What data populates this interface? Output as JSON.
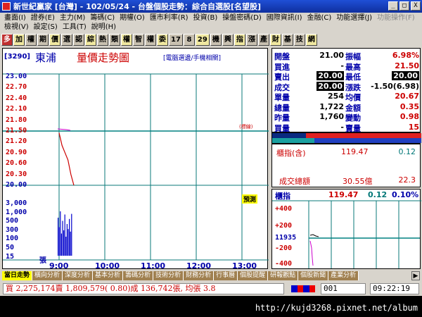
{
  "window": {
    "title": "新世紀贏家 [台灣] - 102/05/24 - 台盤個股走勢：綜合自選股[名望股]",
    "controls": [
      "_",
      "□",
      "X"
    ]
  },
  "menu": {
    "row1": [
      "畫面(I)",
      "證券(E)",
      "主力(M)",
      "籌碼(C)",
      "期權(O)",
      "匯市利率(R)",
      "投資(B)",
      "操盤密碼(D)",
      "國際資訊(I)",
      "金融(C)",
      "功能選擇(J)",
      "功能操作(F)"
    ],
    "row2": [
      "檢視(V)",
      "設定(S)",
      "工具(T)",
      "說明(H)"
    ]
  },
  "toolbar": [
    "多",
    "加",
    "權",
    "期",
    "價",
    "選",
    "認",
    "綜",
    "熱",
    "類",
    "權",
    "智",
    "權",
    "委",
    "17",
    "8",
    "29",
    "機",
    "興",
    "指",
    "漲",
    "產",
    "財",
    "基",
    "技",
    "網"
  ],
  "chart": {
    "code": "[3290]",
    "name": "東浦",
    "title": "量價走勢圖",
    "subnote": "[電腦選邊/手機相關]",
    "ref_note": "(標線)",
    "predict": "預測",
    "price_axis": [
      "23.00",
      "22.70",
      "22.40",
      "22.10",
      "21.80",
      "21.50",
      "21.20",
      "20.90",
      "20.60",
      "20.30",
      "20.00"
    ],
    "volume_axis": [
      "3,000",
      "1,000",
      "500",
      "300",
      "100",
      "50",
      "15"
    ],
    "volume_unit": "張",
    "time_axis": [
      "9:00",
      "10:00",
      "11:00",
      "12:00",
      "13:00"
    ]
  },
  "chart_data": {
    "type": "line",
    "title": "量價走勢圖",
    "xlabel": "",
    "ylabel": "",
    "x": [
      "9:00",
      "9:05",
      "9:10",
      "9:15",
      "9:20",
      "9:22"
    ],
    "series": [
      {
        "values": [
          21.45,
          21.1,
          20.9,
          20.7,
          20.3,
          20.0
        ]
      }
    ],
    "reference_price": 21.5,
    "ylim": [
      20.0,
      23.0
    ],
    "x_ticks": [
      "9:00",
      "10:00",
      "11:00",
      "12:00",
      "13:00"
    ],
    "grid": true
  },
  "quote": {
    "rows": [
      {
        "k1": "開盤",
        "v1": "21.00",
        "k2": "振幅",
        "v2": "6.98%"
      },
      {
        "k1": "買進",
        "v1": "-",
        "k2": "最高",
        "v2": "21.50"
      },
      {
        "k1": "賣出",
        "v1": "20.00",
        "k2": "最低",
        "v2": "20.00"
      },
      {
        "k1": "成交",
        "v1": "20.00",
        "k2": "漲跌",
        "v2": "-1.50(6.98)"
      },
      {
        "k1": "單量",
        "v1": "254",
        "k2": "均價",
        "v2": "20.67"
      },
      {
        "k1": "總量",
        "v1": "1,722",
        "k2": "金額",
        "v2": "0.35"
      },
      {
        "k1": "昨量",
        "v1": "1,760",
        "k2": "變動",
        "v2": "0.98"
      },
      {
        "k1": "買量",
        "v1": "-",
        "k2": "賣量",
        "v2": "15"
      }
    ]
  },
  "index_summary": {
    "label1": "櫃指(含)",
    "value1": "119.47",
    "value1b": "0.12",
    "label2": "成交總額",
    "value2": "30.55億",
    "value2b": "22.3"
  },
  "mini_index": {
    "name": "櫃指",
    "value": "119.47",
    "change": "0.12",
    "pct": "0.10%",
    "axis": [
      "+400",
      "+200",
      "11935",
      "-200",
      "-400"
    ]
  },
  "tabs": [
    "當日走勢",
    "橫向分析",
    "深度分析",
    "基本分析",
    "籌碼分析",
    "技術分析",
    "財務分析",
    "行事曆",
    "個股提醒",
    "研報觀點",
    "個股新聞",
    "產業分析"
  ],
  "status": {
    "ticker": "買 2,275,174賣 1,809,579( 0.80)成 136,742張, 均張 3.8",
    "code": "001",
    "time": "09:22:19"
  },
  "browser": {
    "url": "http://kujd3268.pixnet.net/album"
  },
  "colors": {
    "price_line": "#cc0000",
    "reference_line": "#008080",
    "volume_bar": "#0000cc",
    "avg_line": "#cc00cc"
  }
}
